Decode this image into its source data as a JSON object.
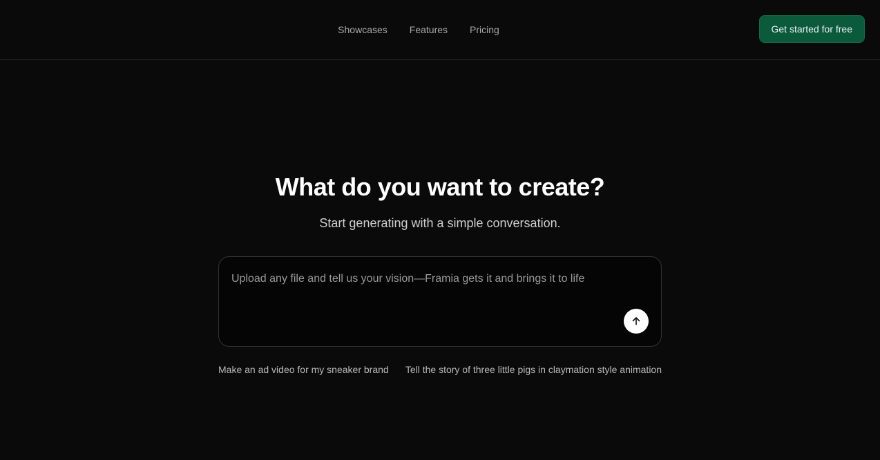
{
  "nav": {
    "links": [
      {
        "label": "Showcases"
      },
      {
        "label": "Features"
      },
      {
        "label": "Pricing"
      }
    ],
    "cta_label": "Get started for free"
  },
  "hero": {
    "title": "What do you want to create?",
    "subtitle": "Start generating with a simple conversation."
  },
  "prompt": {
    "placeholder": "Upload any file and tell us your vision—Framia gets it and brings it to life",
    "value": "",
    "send_icon": "arrow-up-icon"
  },
  "suggestions": [
    {
      "label": "Make an ad video for my sneaker brand"
    },
    {
      "label": "Tell the story of three little pigs in claymation style animation"
    }
  ],
  "colors": {
    "background": "#0a0a0a",
    "cta_bg": "#0b5a3c",
    "border": "#333333"
  }
}
